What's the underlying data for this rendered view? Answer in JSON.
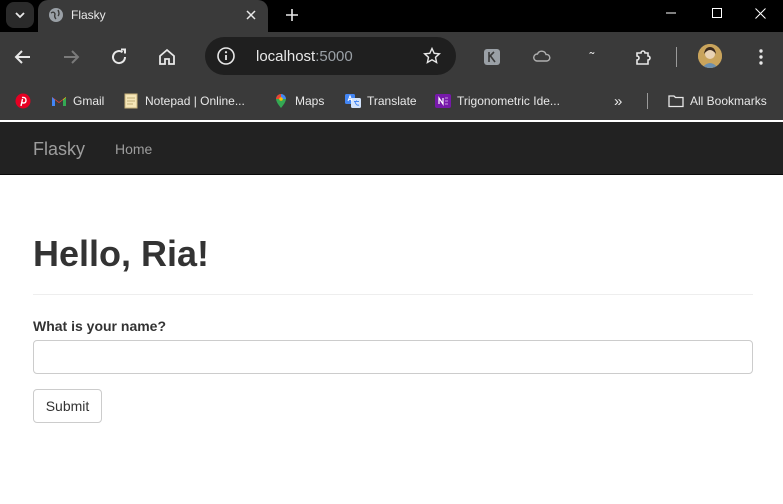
{
  "browser": {
    "tab": {
      "title": "Flasky",
      "favicon": "globe-icon"
    },
    "address": {
      "host": "localhost",
      "port": ":5000"
    },
    "bookmarks": [
      {
        "label": "",
        "icon": "pinterest-icon"
      },
      {
        "label": "Gmail",
        "icon": "gmail-icon"
      },
      {
        "label": "Notepad | Online...",
        "icon": "notepad-icon"
      },
      {
        "label": "Maps",
        "icon": "maps-icon"
      },
      {
        "label": "Translate",
        "icon": "translate-icon"
      },
      {
        "label": "Trigonometric Ide...",
        "icon": "onenote-icon"
      }
    ],
    "all_bookmarks": "All Bookmarks",
    "overflow_glyph": "»",
    "ext3_glyph": "˜"
  },
  "app": {
    "brand": "Flasky",
    "nav": {
      "home": "Home"
    },
    "heading": "Hello, Ria!",
    "form": {
      "name_label": "What is your name?",
      "name_value": "",
      "submit": "Submit"
    }
  },
  "colors": {
    "navbar_bg": "#222222",
    "nav_text": "#9d9d9d",
    "chrome_bg": "#3a3a3a",
    "heading_text": "#333333"
  }
}
